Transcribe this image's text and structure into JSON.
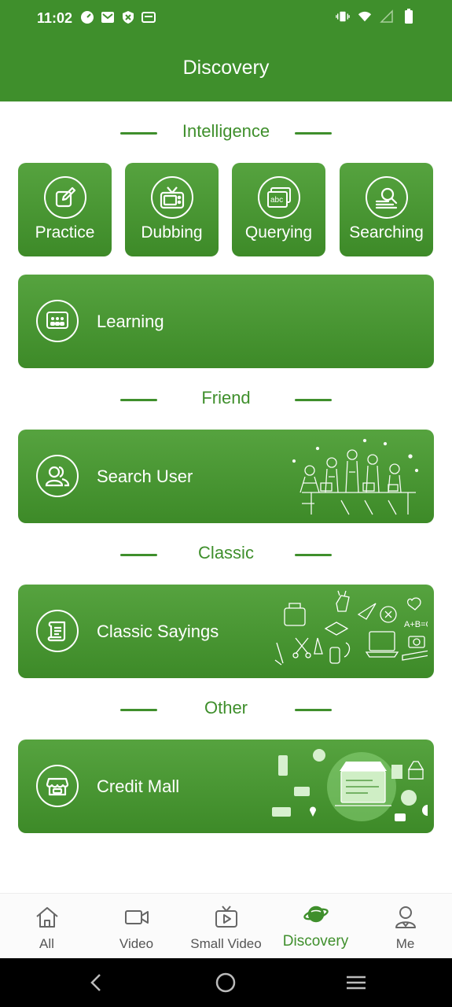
{
  "status_bar": {
    "time": "11:02"
  },
  "header": {
    "title": "Discovery"
  },
  "sections": {
    "intelligence": "Intelligence",
    "friend": "Friend",
    "classic": "Classic",
    "other": "Other"
  },
  "tiles": [
    {
      "label": "Practice",
      "icon": "edit-icon"
    },
    {
      "label": "Dubbing",
      "icon": "tv-icon"
    },
    {
      "label": "Querying",
      "icon": "abc-icon"
    },
    {
      "label": "Searching",
      "icon": "search-doc-icon"
    }
  ],
  "cards": {
    "learning": "Learning",
    "search_user": "Search User",
    "classic_sayings": "Classic Sayings",
    "credit_mall": "Credit Mall"
  },
  "bottom_nav": [
    {
      "label": "All",
      "icon": "home-icon"
    },
    {
      "label": "Video",
      "icon": "video-camera-icon"
    },
    {
      "label": "Small Video",
      "icon": "small-video-icon"
    },
    {
      "label": "Discovery",
      "icon": "planet-icon",
      "active": true
    },
    {
      "label": "Me",
      "icon": "person-icon"
    }
  ],
  "colors": {
    "primary": "#3f8f2c",
    "tile_top": "#56a33f",
    "tile_bottom": "#3d8a28"
  }
}
